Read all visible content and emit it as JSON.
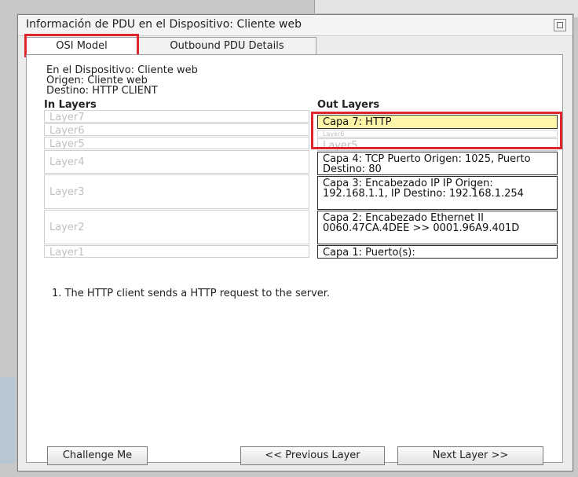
{
  "dialog": {
    "title": "Información de PDU en el Dispositivo: Cliente web"
  },
  "tabs": [
    {
      "label": "OSI Model",
      "active": true
    },
    {
      "label": "Outbound PDU Details",
      "active": false
    }
  ],
  "info": {
    "device_line": "En el Dispositivo: Cliente web",
    "origin_line": "Origen: Cliente web",
    "dest_line": "Destino: HTTP CLIENT"
  },
  "in_layers": {
    "header": "In Layers",
    "items": [
      "Layer7",
      "Layer6",
      "Layer5",
      "Layer4",
      "Layer3",
      "Layer2",
      "Layer1"
    ]
  },
  "out_layers": {
    "header": "Out Layers",
    "items": [
      "Capa 7: HTTP",
      "Layer6",
      "Layer5",
      "Capa 4: TCP Puerto Origen: 1025, Puerto Destino: 80",
      "Capa 3: Encabezado IP IP Origen: 192.168.1.1, IP Destino: 192.168.1.254",
      "Capa 2: Encabezado Ethernet II 0060.47CA.4DEE >> 0001.96A9.401D",
      "Capa 1: Puerto(s):"
    ]
  },
  "step_description": "1. The HTTP client sends a HTTP request to the server.",
  "buttons": {
    "challenge": "Challenge Me",
    "previous": "<< Previous Layer",
    "next": "Next Layer >>"
  },
  "colors": {
    "highlight": "#fdf5a7",
    "annotation_red": "#e0262a"
  }
}
